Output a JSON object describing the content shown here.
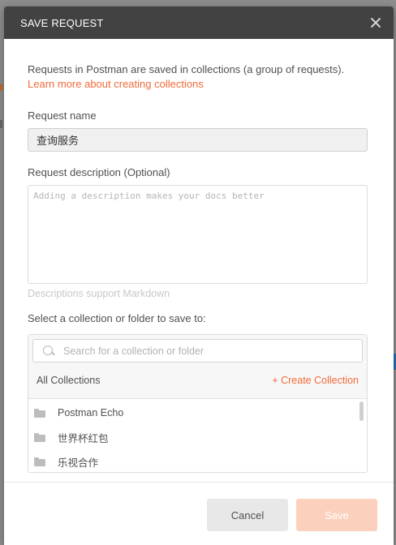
{
  "modal": {
    "title": "SAVE REQUEST",
    "intro": "Requests in Postman are saved in collections (a group of requests).",
    "learn_more": "Learn more about creating collections"
  },
  "request_name": {
    "label": "Request name",
    "value": "查询服务"
  },
  "request_description": {
    "label": "Request description (Optional)",
    "placeholder": "Adding a description makes your docs better",
    "hint": "Descriptions support Markdown"
  },
  "collections": {
    "label": "Select a collection or folder to save to:",
    "search_placeholder": "Search for a collection or folder",
    "all_label": "All Collections",
    "create_label": "+ Create Collection",
    "items": [
      {
        "label": "Postman Echo"
      },
      {
        "label": "世界杯红包"
      },
      {
        "label": "乐视合作"
      }
    ]
  },
  "footer": {
    "cancel_label": "Cancel",
    "save_label": "Save"
  },
  "colors": {
    "accent": "#f26b3a",
    "header_bg": "#424242",
    "save_disabled_bg": "#fbd1bd"
  },
  "icons": [
    "close-icon",
    "search-icon",
    "folder-icon"
  ]
}
